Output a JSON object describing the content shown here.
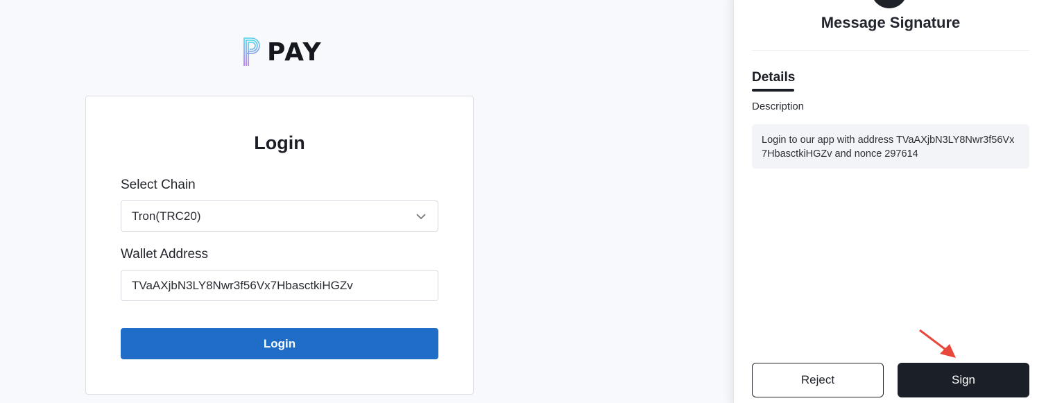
{
  "logo": {
    "text": "PAY",
    "icon": "p-logo-icon"
  },
  "login_card": {
    "title": "Login",
    "chain_label": "Select Chain",
    "chain_value": "Tron(TRC20)",
    "wallet_label": "Wallet Address",
    "wallet_value": "TVaAXjbN3LY8Nwr3f56Vx7HbasctkiHGZv",
    "login_button": "Login"
  },
  "signature_panel": {
    "title": "Message Signature",
    "tab": "Details",
    "description_label": "Description",
    "description_text": "Login to our app with address TVaAXjbN3LY8Nwr3f56Vx7HbasctkiHGZv and nonce 297614",
    "reject_button": "Reject",
    "sign_button": "Sign"
  },
  "colors": {
    "accent_blue": "#1f6dc6",
    "dark": "#1b1f27",
    "pointer": "#e8473c"
  },
  "icons": [
    "chevron-down-icon",
    "pointer-arrow-icon"
  ]
}
